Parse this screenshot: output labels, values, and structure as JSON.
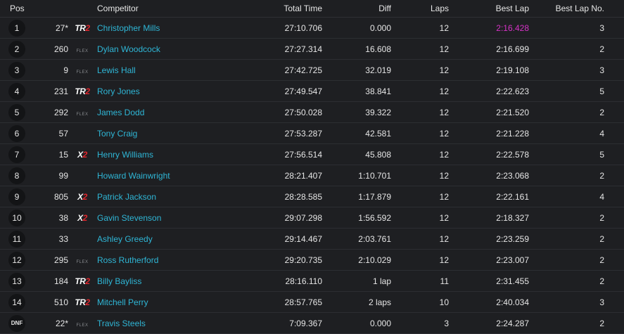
{
  "headers": {
    "pos": "Pos",
    "competitor": "Competitor",
    "total_time": "Total Time",
    "diff": "Diff",
    "laps": "Laps",
    "best_lap": "Best Lap",
    "best_lap_no": "Best Lap No."
  },
  "class_logos": {
    "TR2": {
      "a": "TR",
      "b": "2"
    },
    "X2": {
      "a": "X",
      "b": "2"
    },
    "FLEX": {
      "a": "FLEX",
      "b": ""
    }
  },
  "colors": {
    "background": "#1e1f22",
    "name_link": "#2fb6d6",
    "fastest_lap": "#d632c6",
    "logo_red": "#e0262d"
  },
  "rows": [
    {
      "pos": "1",
      "num": "27*",
      "class": "TR2",
      "name": "Christopher Mills",
      "total_time": "27:10.706",
      "diff": "0.000",
      "laps": "12",
      "best_lap": "2:16.428",
      "best_lap_no": "3",
      "fastest": true
    },
    {
      "pos": "2",
      "num": "260",
      "class": "FLEX",
      "name": "Dylan Woodcock",
      "total_time": "27:27.314",
      "diff": "16.608",
      "laps": "12",
      "best_lap": "2:16.699",
      "best_lap_no": "2"
    },
    {
      "pos": "3",
      "num": "9",
      "class": "FLEX",
      "name": "Lewis Hall",
      "total_time": "27:42.725",
      "diff": "32.019",
      "laps": "12",
      "best_lap": "2:19.108",
      "best_lap_no": "3"
    },
    {
      "pos": "4",
      "num": "231",
      "class": "TR2",
      "name": "Rory Jones",
      "total_time": "27:49.547",
      "diff": "38.841",
      "laps": "12",
      "best_lap": "2:22.623",
      "best_lap_no": "5"
    },
    {
      "pos": "5",
      "num": "292",
      "class": "FLEX",
      "name": "James Dodd",
      "total_time": "27:50.028",
      "diff": "39.322",
      "laps": "12",
      "best_lap": "2:21.520",
      "best_lap_no": "2"
    },
    {
      "pos": "6",
      "num": "57",
      "class": "",
      "name": "Tony Craig",
      "total_time": "27:53.287",
      "diff": "42.581",
      "laps": "12",
      "best_lap": "2:21.228",
      "best_lap_no": "4"
    },
    {
      "pos": "7",
      "num": "15",
      "class": "X2",
      "name": "Henry Williams",
      "total_time": "27:56.514",
      "diff": "45.808",
      "laps": "12",
      "best_lap": "2:22.578",
      "best_lap_no": "5"
    },
    {
      "pos": "8",
      "num": "99",
      "class": "",
      "name": "Howard Wainwright",
      "total_time": "28:21.407",
      "diff": "1:10.701",
      "laps": "12",
      "best_lap": "2:23.068",
      "best_lap_no": "2"
    },
    {
      "pos": "9",
      "num": "805",
      "class": "X2",
      "name": "Patrick Jackson",
      "total_time": "28:28.585",
      "diff": "1:17.879",
      "laps": "12",
      "best_lap": "2:22.161",
      "best_lap_no": "4"
    },
    {
      "pos": "10",
      "num": "38",
      "class": "X2",
      "name": "Gavin Stevenson",
      "total_time": "29:07.298",
      "diff": "1:56.592",
      "laps": "12",
      "best_lap": "2:18.327",
      "best_lap_no": "2"
    },
    {
      "pos": "11",
      "num": "33",
      "class": "",
      "name": "Ashley Greedy",
      "total_time": "29:14.467",
      "diff": "2:03.761",
      "laps": "12",
      "best_lap": "2:23.259",
      "best_lap_no": "2"
    },
    {
      "pos": "12",
      "num": "295",
      "class": "FLEX",
      "name": "Ross Rutherford",
      "total_time": "29:20.735",
      "diff": "2:10.029",
      "laps": "12",
      "best_lap": "2:23.007",
      "best_lap_no": "2"
    },
    {
      "pos": "13",
      "num": "184",
      "class": "TR2",
      "name": "Billy Bayliss",
      "total_time": "28:16.110",
      "diff": "1 lap",
      "laps": "11",
      "best_lap": "2:31.455",
      "best_lap_no": "2"
    },
    {
      "pos": "14",
      "num": "510",
      "class": "TR2",
      "name": "Mitchell Perry",
      "total_time": "28:57.765",
      "diff": "2 laps",
      "laps": "10",
      "best_lap": "2:40.034",
      "best_lap_no": "3"
    },
    {
      "pos": "DNF",
      "num": "22*",
      "class": "FLEX",
      "name": "Travis Steels",
      "total_time": "7:09.367",
      "diff": "0.000",
      "laps": "3",
      "best_lap": "2:24.287",
      "best_lap_no": "2"
    }
  ]
}
